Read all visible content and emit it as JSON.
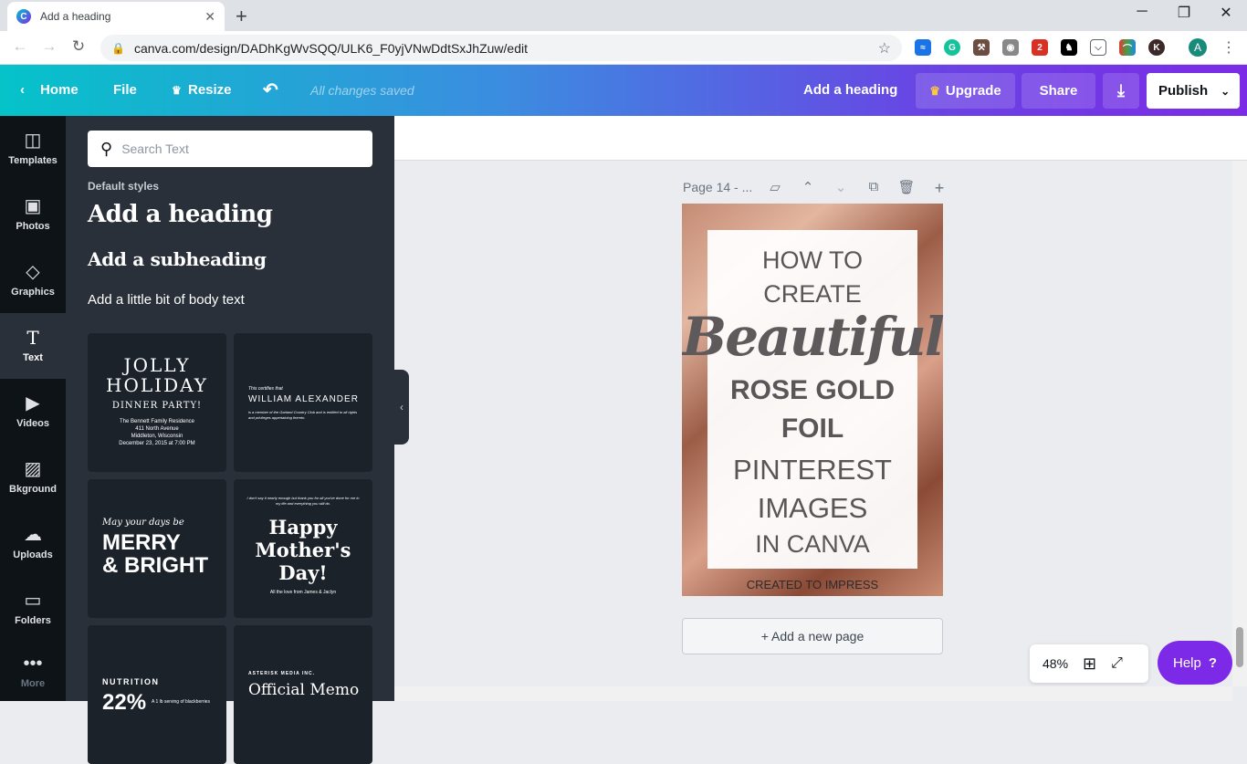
{
  "browser": {
    "tab_title": "Add a heading",
    "url": "canva.com/design/DADhKgWvSQQ/ULK6_F0yjVNwDdtSxJhZuw/edit",
    "profile_initial": "A",
    "extension_badge": "2"
  },
  "header": {
    "home_label": "Home",
    "file_label": "File",
    "resize_label": "Resize",
    "saved_status": "All changes saved",
    "doc_title": "Add a heading",
    "upgrade_label": "Upgrade",
    "share_label": "Share",
    "publish_label": "Publish",
    "colors": {
      "gradient_start": "#05c3c9",
      "gradient_end": "#7b2be6"
    }
  },
  "rail": {
    "items": [
      {
        "label": "Templates",
        "icon": "templates-icon"
      },
      {
        "label": "Photos",
        "icon": "photos-icon"
      },
      {
        "label": "Graphics",
        "icon": "graphics-icon"
      },
      {
        "label": "Text",
        "icon": "text-icon",
        "active": true
      },
      {
        "label": "Videos",
        "icon": "videos-icon"
      },
      {
        "label": "Bkground",
        "icon": "background-icon"
      },
      {
        "label": "Uploads",
        "icon": "uploads-icon"
      },
      {
        "label": "Folders",
        "icon": "folders-icon"
      },
      {
        "label": "More",
        "icon": "more-icon"
      }
    ]
  },
  "panel": {
    "search_placeholder": "Search Text",
    "default_styles_label": "Default styles",
    "heading": "Add a heading",
    "subheading": "Add a subheading",
    "body": "Add a little bit of body text",
    "cards": {
      "jolly": {
        "line1": "JOLLY",
        "line2": "HOLIDAY",
        "line3": "DINNER PARTY!",
        "line4": "The Bennett Family Residence",
        "line5": "411 North Avenue",
        "line6": "Middleton, Wisconsin",
        "line7": "December 23, 2015 at 7:00 PM"
      },
      "certify": {
        "line1": "This certifies that",
        "line2": "WILLIAM ALEXANDER",
        "line3": "is a member of the Garland Country Club and is entitled to all rights and privileges appertaining thereto."
      },
      "merry": {
        "line1": "May your days be",
        "line2": "MERRY",
        "line3": "& BRIGHT"
      },
      "mother": {
        "line1": "I don't say it nearly enough but thank you for all you've done for me in my life and everything you still do.",
        "line2": "Happy",
        "line3": "Mother's",
        "line4": "Day!",
        "line5": "All the love from James & Jaclyn"
      },
      "nutrition": {
        "line1": "NUTRITION",
        "line2": "22%",
        "line3": "A 1 lb serving of blackberries"
      },
      "memo": {
        "line1": "ASTERISK MEDIA INC.",
        "line2": "Official Memo"
      }
    }
  },
  "canvas": {
    "page_label": "Page 14 - ...",
    "design": {
      "line1": "HOW TO",
      "line2": "CREATE",
      "line3": "Beautiful",
      "line4": "ROSE GOLD",
      "line5": "FOIL",
      "line6": "PINTEREST",
      "line7": "IMAGES",
      "line8": "IN CANVA",
      "footer": "CREATED TO IMPRESS"
    },
    "add_page_label": "+ Add a new page",
    "zoom": "48%",
    "help_label": "Help"
  }
}
